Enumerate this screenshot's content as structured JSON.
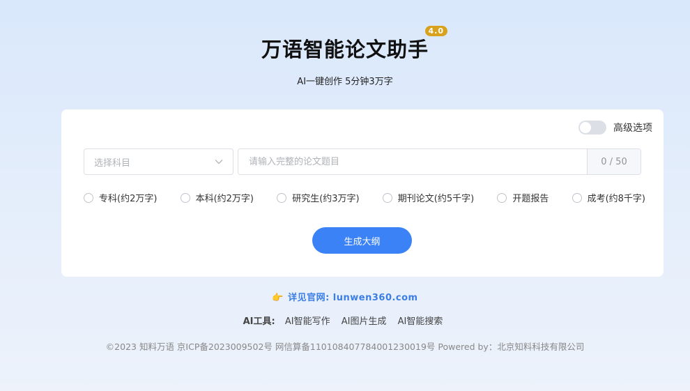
{
  "header": {
    "title": "万语智能论文助手",
    "version": "4.0",
    "subtitle": "AI一键创作 5分钟3万字"
  },
  "form": {
    "advanced_label": "高级选项",
    "advanced_enabled": false,
    "subject_placeholder": "选择科目",
    "topic_placeholder": "请输入完整的论文题目",
    "topic_value": "",
    "counter": "0 / 50",
    "paper_types": [
      "专科(约2万字)",
      "本科(约2万字)",
      "研究生(约3万字)",
      "期刊论文(约5千字)",
      "开题报告",
      "成考(约8千字)"
    ],
    "generate_label": "生成大纲"
  },
  "links": {
    "official_site": "详见官网: lunwen360.com",
    "tools_label": "AI工具:",
    "tools": [
      "AI智能写作",
      "AI图片生成",
      "AI智能搜索"
    ]
  },
  "footer": {
    "copyright": "©2023 知料万语 京ICP备2023009502号 网信算备110108407784001230019号 Powered by：北京知料科技有限公司"
  },
  "colors": {
    "accent": "#3b82f6",
    "badge": "#d8a21e",
    "link": "#3b7ee6"
  }
}
